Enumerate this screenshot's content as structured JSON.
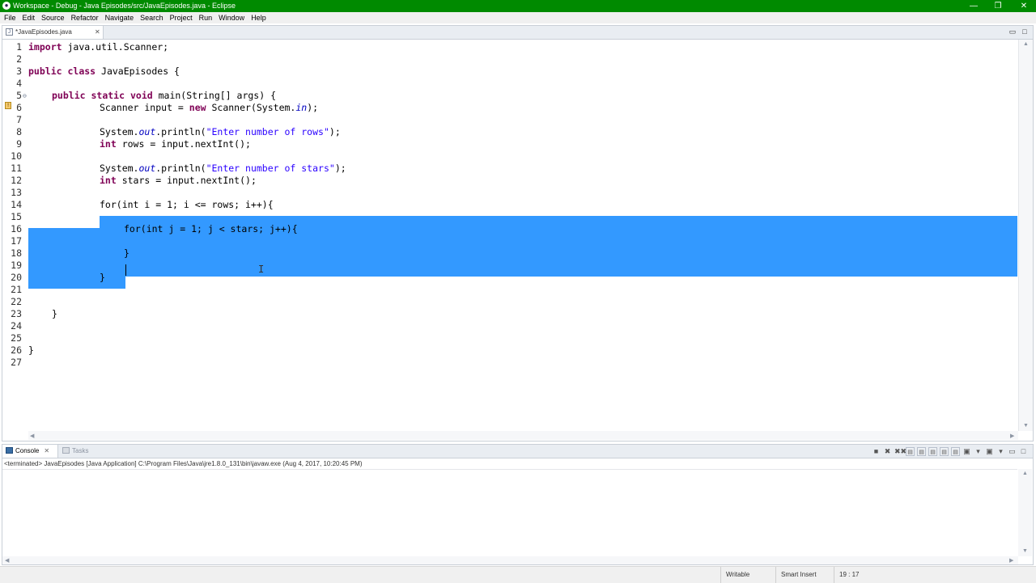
{
  "window": {
    "title": "Workspace - Debug - Java Episodes/src/JavaEpisodes.java - Eclipse",
    "app_icon": "eclipse-icon",
    "controls": {
      "minimize": "—",
      "restore": "❐",
      "close": "✕"
    },
    "title_bar_color": "#008a00"
  },
  "menu": [
    "File",
    "Edit",
    "Source",
    "Refactor",
    "Navigate",
    "Search",
    "Project",
    "Run",
    "Window",
    "Help"
  ],
  "editor": {
    "tab_label": "*JavaEpisodes.java",
    "tab_icon": "java-file-icon",
    "tab_close": "✕",
    "view_controls": {
      "minimize": "▭",
      "maximize": "□"
    },
    "lines": [
      {
        "n": "1"
      },
      {
        "n": "2"
      },
      {
        "n": "3"
      },
      {
        "n": "4"
      },
      {
        "n": "5"
      },
      {
        "n": "6"
      },
      {
        "n": "7"
      },
      {
        "n": "8"
      },
      {
        "n": "9"
      },
      {
        "n": "10"
      },
      {
        "n": "11"
      },
      {
        "n": "12"
      },
      {
        "n": "13"
      },
      {
        "n": "14"
      },
      {
        "n": "15"
      },
      {
        "n": "16"
      },
      {
        "n": "17"
      },
      {
        "n": "18"
      },
      {
        "n": "19"
      },
      {
        "n": "20"
      },
      {
        "n": "21"
      },
      {
        "n": "22"
      },
      {
        "n": "23"
      },
      {
        "n": "24"
      },
      {
        "n": "25"
      },
      {
        "n": "26"
      },
      {
        "n": "27"
      }
    ],
    "code": {
      "l1_kw": "import",
      "l1_rest": " java.util.Scanner;",
      "l3_kw1": "public",
      "l3_kw2": "class",
      "l3_rest": " JavaEpisodes {",
      "l5_kw1": "public",
      "l5_kw2": "static",
      "l5_kw3": "void",
      "l5_rest": " main(String[] args) {",
      "l6_a": "Scanner input = ",
      "l6_kw": "new",
      "l6_b": " Scanner(System.",
      "l6_fld": "in",
      "l6_c": ");",
      "l8_a": "System.",
      "l8_fld": "out",
      "l8_b": ".println(",
      "l8_str": "\"Enter number of rows\"",
      "l8_c": ");",
      "l9_kw": "int",
      "l9_rest": " rows = input.nextInt();",
      "l11_a": "System.",
      "l11_fld": "out",
      "l11_b": ".println(",
      "l11_str": "\"Enter number of stars\"",
      "l11_c": ");",
      "l12_kw": "int",
      "l12_rest": " stars = input.nextInt();",
      "l14": "for(int i = 1; i <= rows; i++){",
      "l16": "for(int j = 1; j < stars; j++){",
      "l18": "}",
      "l20": "}",
      "l23": "}",
      "l26": "}"
    },
    "fold_marker": "⊖",
    "selection_color": "#3399ff"
  },
  "console": {
    "tab_label": "Console",
    "tab_close": "✕",
    "tasks_label": "Tasks",
    "status": "<terminated> JavaEpisodes [Java Application] C:\\Program Files\\Java\\jre1.8.0_131\\bin\\javaw.exe (Aug 4, 2017, 10:20:45 PM)",
    "toolbar": [
      "■",
      "✖",
      "✖✖",
      "▤",
      "▤",
      "▤",
      "▤",
      "▤",
      "▣",
      "▾",
      "▣",
      "▾",
      "▭",
      "□"
    ]
  },
  "status_bar": {
    "mode": "Writable",
    "insert": "Smart Insert",
    "position": "19 : 17"
  }
}
